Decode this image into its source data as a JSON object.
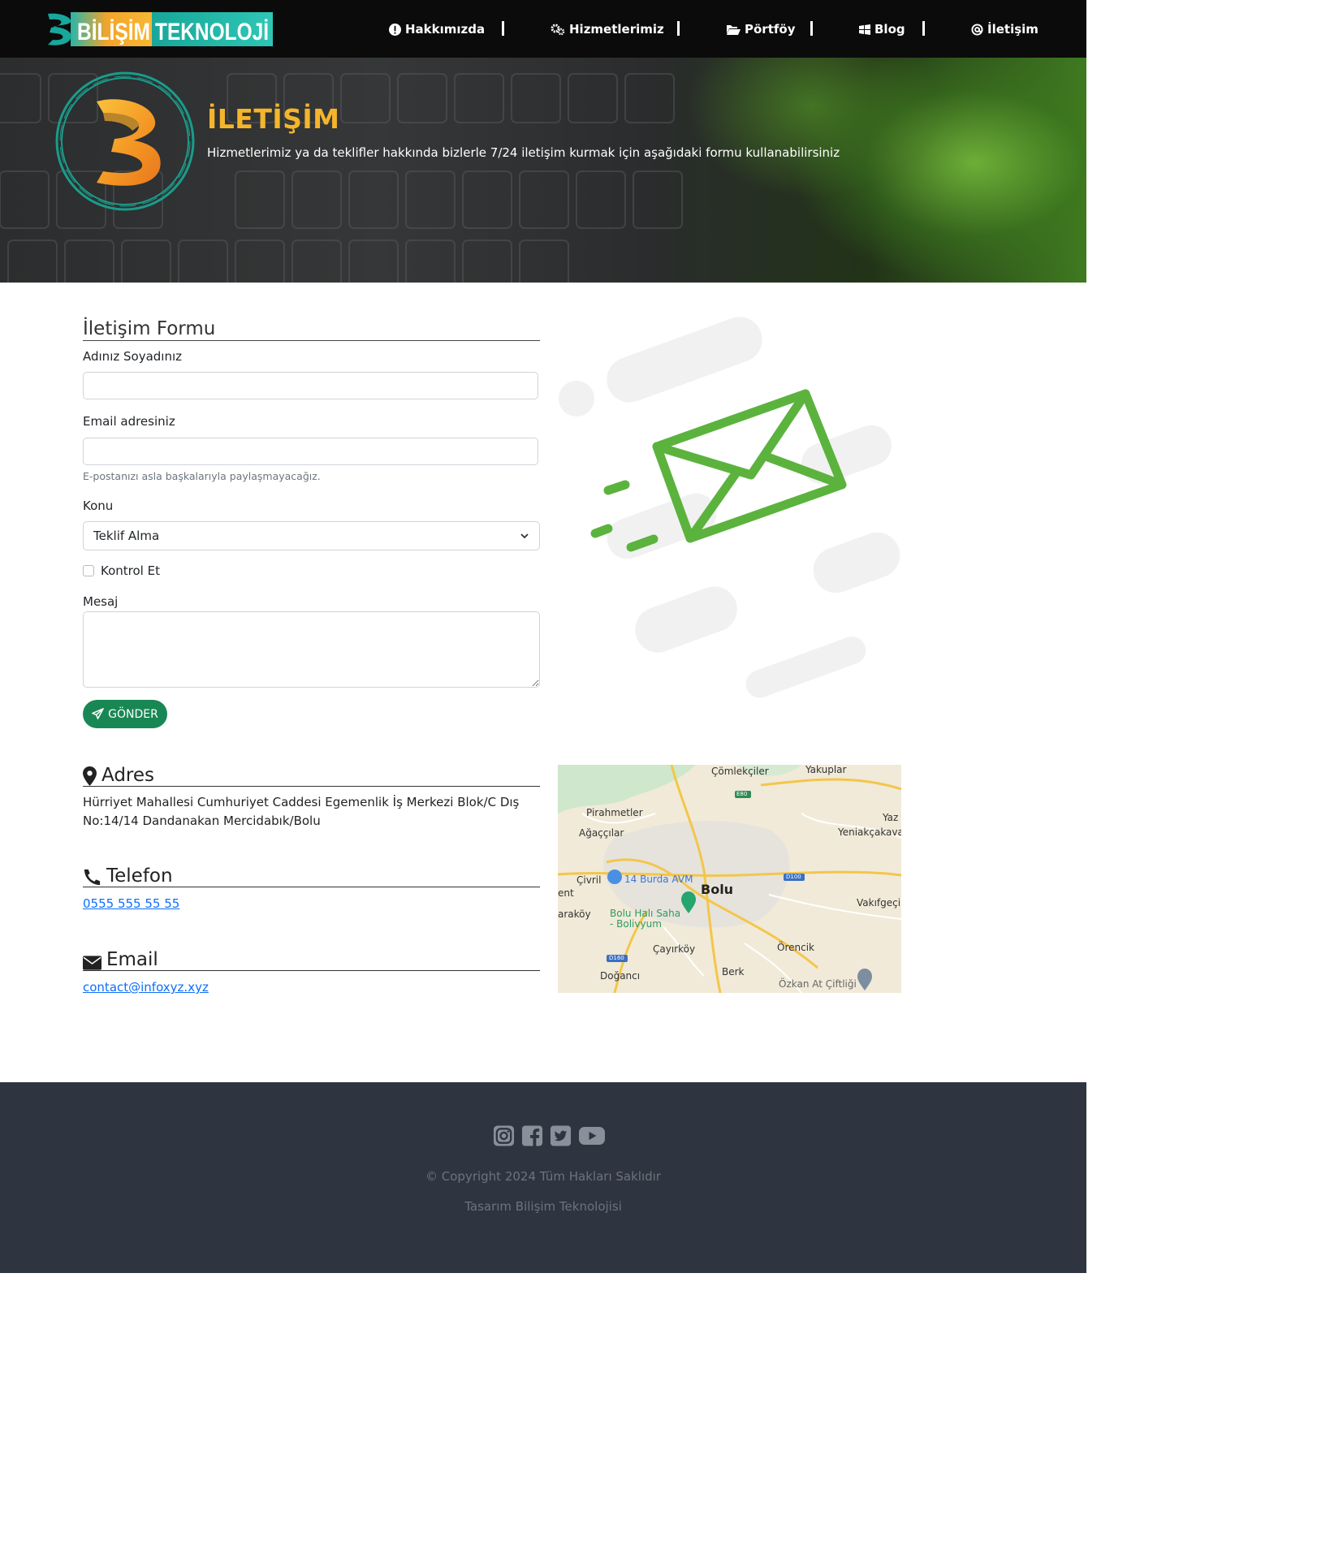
{
  "brand": {
    "logo_text_1": "BİLİŞİM",
    "logo_text_2": "TEKNOLOJİ"
  },
  "nav": {
    "items": [
      {
        "label": "Hakkımızda",
        "icon": "exclamation-circle-icon"
      },
      {
        "label": "Hizmetlerimiz",
        "icon": "gears-icon"
      },
      {
        "label": "Pörtföy",
        "icon": "folder-open-icon"
      },
      {
        "label": "Blog",
        "icon": "windows-icon"
      },
      {
        "label": "İletişim",
        "icon": "at-icon"
      }
    ]
  },
  "hero": {
    "title": "İLETİŞİM",
    "subtitle": "Hizmetlerimiz ya da teklifler hakkında bizlerle 7/24 iletişim kurmak için aşağıdaki formu kullanabilirsiniz"
  },
  "form": {
    "title": "İletişim Formu",
    "name_label": "Adınız Soyadınız",
    "name_value": "",
    "email_label": "Email adresiniz",
    "email_value": "",
    "email_help": "E-postanızı asla başkalarıyla paylaşmayacağız.",
    "subject_label": "Konu",
    "subject_selected": "Teklif Alma",
    "check_label": "Kontrol Et",
    "checked": false,
    "message_label": "Mesaj",
    "message_value": "",
    "submit_label": "GÖNDER"
  },
  "contact": {
    "address_title": "Adres",
    "address_text": "Hürriyet Mahallesi Cumhuriyet Caddesi Egemenlik İş Merkezi Blok/C Dış No:14/14 Dandanakan Mercidabık/Bolu",
    "phone_title": "Telefon",
    "phone_value": "0555 555 55 55",
    "email_title": "Email",
    "email_value": "contact@infoxyz.xyz"
  },
  "map": {
    "labels": {
      "comlekciler": "Çömlekçiler",
      "yakuplar": "Yakuplar",
      "pirahmetler": "Pirahmetler",
      "agaccilar": "Ağaççılar",
      "yaz": "Yaz",
      "yeniakcakava": "Yeniakçakava",
      "civril": "Çivril",
      "avm": "14 Burda AVM",
      "bolu": "Bolu",
      "ent": "ent",
      "vakifgeci": "Vakıfgeçi",
      "arakoy": "araköy",
      "halisaha": "Bolu Halı Saha\n- Bolivyum",
      "cayirkoy": "Çayırköy",
      "orencik": "Örencik",
      "dogance": "Doğancı",
      "berk": "Berk",
      "ozkan": "Özkan At Çiftliği",
      "e80": "E80",
      "d100": "D100",
      "d160": "D160"
    }
  },
  "footer": {
    "social": [
      "instagram-icon",
      "facebook-icon",
      "twitter-icon",
      "youtube-icon"
    ],
    "copyright": "© Copyright 2024 Tüm Hakları Saklıdır",
    "design": "Tasarım Bilişim Teknolojisi"
  },
  "colors": {
    "nav_bg": "#0b0b0b",
    "hero_title": "#f5b52a",
    "button": "#198754",
    "envelope": "#5bb33e",
    "link": "#0d6efd",
    "footer_bg": "#2f3540"
  }
}
